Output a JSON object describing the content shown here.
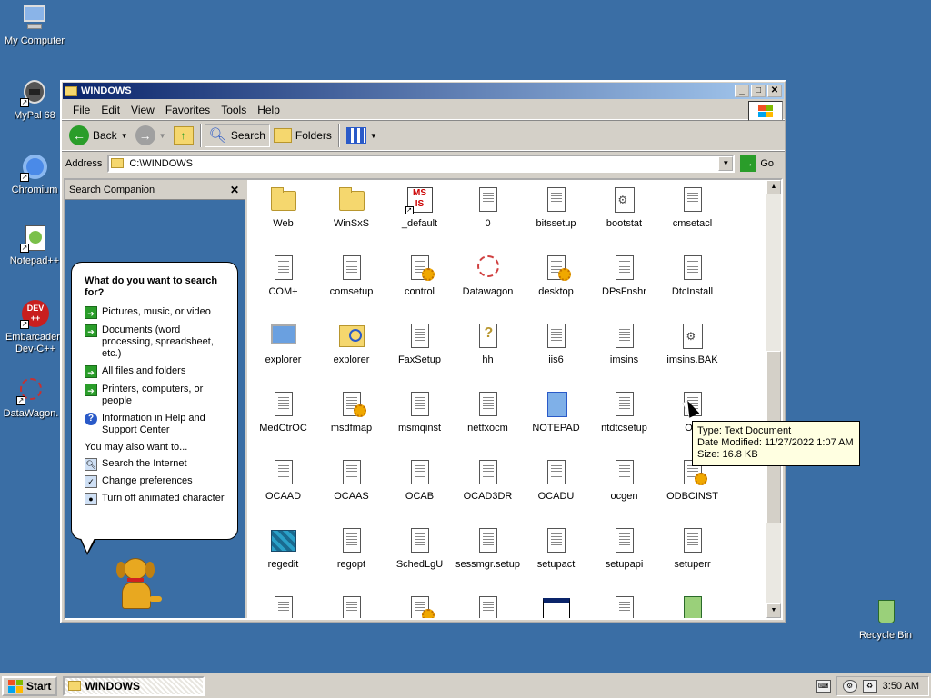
{
  "desktop": {
    "icons": [
      {
        "label": "My Computer",
        "icon": "my-computer-icon"
      },
      {
        "label": "MyPal 68",
        "icon": "mypal-icon"
      },
      {
        "label": "Chromium",
        "icon": "chromium-icon"
      },
      {
        "label": "Notepad++",
        "icon": "notepadpp-icon"
      },
      {
        "label": "Embarcadero Dev-C++",
        "icon": "devcpp-icon"
      },
      {
        "label": "DataWagon.",
        "icon": "datawagon-icon"
      },
      {
        "label": "Recycle Bin",
        "icon": "recycle-bin-icon"
      }
    ],
    "devcpp_badge": "DEV\n++"
  },
  "window": {
    "title": "WINDOWS",
    "menu": [
      "File",
      "Edit",
      "View",
      "Favorites",
      "Tools",
      "Help"
    ],
    "toolbar": {
      "back": "Back",
      "search": "Search",
      "folders": "Folders"
    },
    "address_label": "Address",
    "address_value": "C:\\WINDOWS",
    "go_label": "Go"
  },
  "companion": {
    "header": "Search Companion",
    "question": "What do you want to search for?",
    "options": [
      "Pictures, music, or video",
      "Documents (word processing, spreadsheet, etc.)",
      "All files and folders",
      "Printers, computers, or people",
      "Information in Help and Support Center"
    ],
    "also_label": "You may also want to...",
    "also_items": [
      "Search the Internet",
      "Change preferences",
      "Turn off animated character"
    ]
  },
  "files": [
    {
      "name": "Web",
      "type": "folder"
    },
    {
      "name": "WinSxS",
      "type": "folder"
    },
    {
      "name": "_default",
      "type": "msi"
    },
    {
      "name": "0",
      "type": "doc"
    },
    {
      "name": "bitssetup",
      "type": "doc"
    },
    {
      "name": "bootstat",
      "type": "cfgdoc"
    },
    {
      "name": "cmsetacl",
      "type": "doc"
    },
    {
      "name": "COM+",
      "type": "doc"
    },
    {
      "name": "comsetup",
      "type": "doc"
    },
    {
      "name": "control",
      "type": "docgear"
    },
    {
      "name": "Datawagon",
      "type": "spiro"
    },
    {
      "name": "desktop",
      "type": "docgear"
    },
    {
      "name": "DPsFnshr",
      "type": "doc"
    },
    {
      "name": "DtcInstall",
      "type": "doc"
    },
    {
      "name": "explorer",
      "type": "monitor"
    },
    {
      "name": "explorer",
      "type": "magnifier"
    },
    {
      "name": "FaxSetup",
      "type": "doc"
    },
    {
      "name": "hh",
      "type": "help"
    },
    {
      "name": "iis6",
      "type": "doc"
    },
    {
      "name": "imsins",
      "type": "doc"
    },
    {
      "name": "imsins.BAK",
      "type": "cfgdoc"
    },
    {
      "name": "MedCtrOC",
      "type": "doc"
    },
    {
      "name": "msdfmap",
      "type": "docgear"
    },
    {
      "name": "msmqinst",
      "type": "doc"
    },
    {
      "name": "netfxocm",
      "type": "doc"
    },
    {
      "name": "NOTEPAD",
      "type": "notepad"
    },
    {
      "name": "ntdtcsetup",
      "type": "doc"
    },
    {
      "name": "OC",
      "type": "doc"
    },
    {
      "name": "OCAAD",
      "type": "doc"
    },
    {
      "name": "OCAAS",
      "type": "doc"
    },
    {
      "name": "OCAB",
      "type": "doc"
    },
    {
      "name": "OCAD3DR",
      "type": "doc"
    },
    {
      "name": "OCADU",
      "type": "doc"
    },
    {
      "name": "ocgen",
      "type": "doc"
    },
    {
      "name": "ODBCINST",
      "type": "docgear"
    },
    {
      "name": "regedit",
      "type": "regedit"
    },
    {
      "name": "regopt",
      "type": "doc"
    },
    {
      "name": "SchedLgU",
      "type": "doc"
    },
    {
      "name": "sessmgr.setup",
      "type": "doc"
    },
    {
      "name": "setupact",
      "type": "doc"
    },
    {
      "name": "setupapi",
      "type": "doc"
    },
    {
      "name": "setuperr",
      "type": "doc"
    },
    {
      "name": "",
      "type": "doc"
    },
    {
      "name": "",
      "type": "doc"
    },
    {
      "name": "",
      "type": "docgear"
    },
    {
      "name": "",
      "type": "doc"
    },
    {
      "name": "",
      "type": "appwin"
    },
    {
      "name": "",
      "type": "doc"
    },
    {
      "name": "",
      "type": "recycle"
    }
  ],
  "tooltip": {
    "type": "Type: Text Document",
    "modified": "Date Modified: 11/27/2022 1:07 AM",
    "size": "Size: 16.8 KB"
  },
  "taskbar": {
    "start": "Start",
    "task": "WINDOWS",
    "clock": "3:50 AM"
  },
  "colors": {
    "desktop": "#3a6ea5",
    "title_start": "#0a246a",
    "title_end": "#a6caf0"
  }
}
